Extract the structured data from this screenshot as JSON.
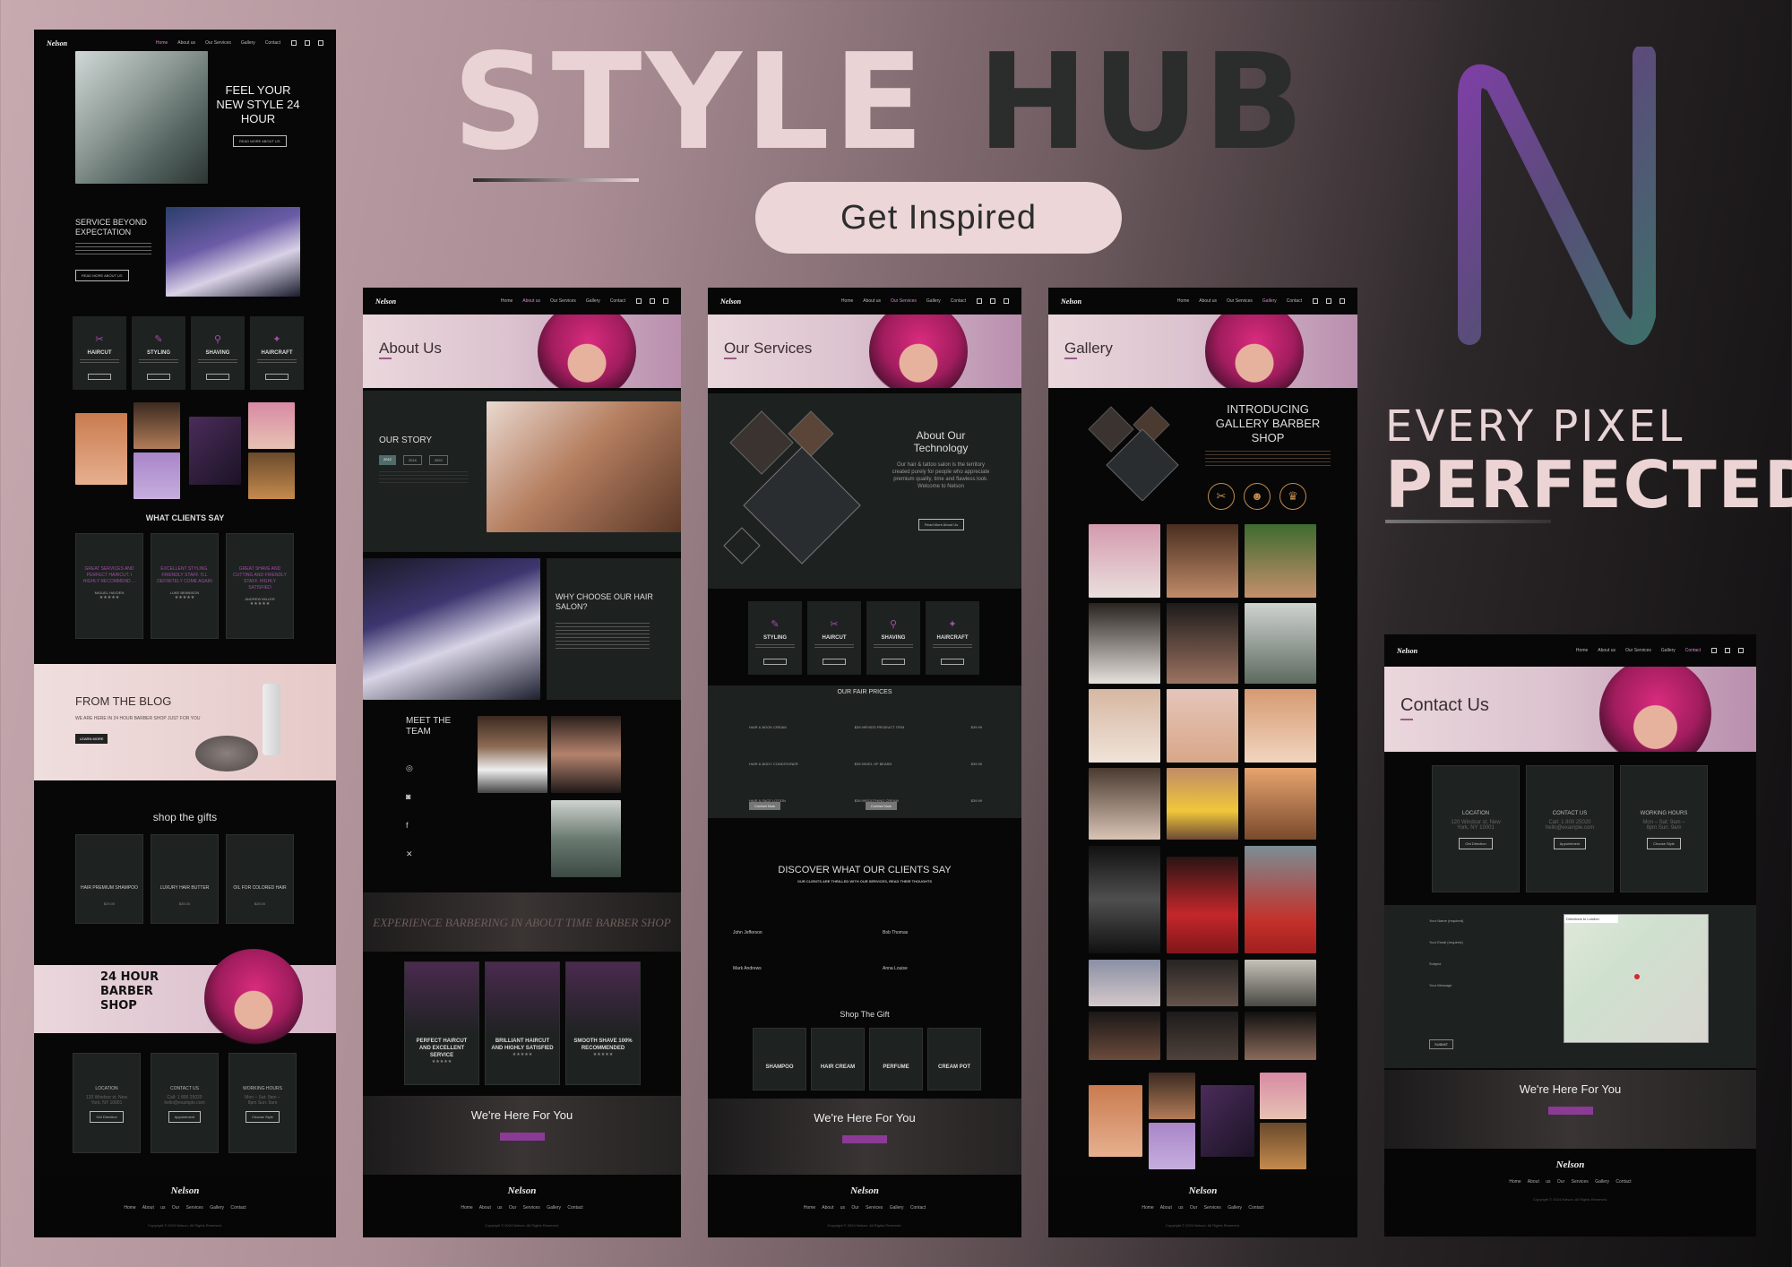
{
  "hero": {
    "title_part1": "STYLE",
    "title_part2": "HUB",
    "cta": "Get Inspired",
    "tagline_line1": "EVERY PIXEL",
    "tagline_line2": "PERFECTED",
    "logo_letter": "N"
  },
  "colors": {
    "accent": "#8b3b96",
    "pink": "#ecd6d7",
    "dark": "#070707",
    "card": "#1e2221"
  },
  "nav": {
    "logo": "Nelson",
    "links": [
      "Home",
      "About us",
      "Our Services",
      "Gallery",
      "Contact"
    ]
  },
  "home": {
    "hero_heading": "FEEL YOUR NEW STYLE 24 HOUR",
    "hero_button": "READ MORE ABOUT US",
    "service_heading": "SERVICE BEYOND EXPECTATION",
    "service_button": "READ MORE ABOUT US",
    "services": [
      "HAIRCUT",
      "STYLING",
      "SHAVING",
      "HAIRCRAFT"
    ],
    "service_btn": "Read more",
    "testimonials_heading": "WHAT CLIENTS SAY",
    "testimonials": [
      {
        "quote": "GREAT SERVICES AND PERFECT HAIRCUT. I HIGHLY RECOMMEND ...",
        "name": "MIGUEL HAYDEN"
      },
      {
        "quote": "EXCELLENT STYLING. FRIENDLY STAFF. I'LL DEFINITELY COME AGAIN",
        "name": "LUKE BENNISON"
      },
      {
        "quote": "GREAT SHAVE AND CUTTING AND FRIENDLY STAFF. HIGHLY SATISFIED",
        "name": "ANDREW MILLER"
      }
    ],
    "stars": "★★★★★",
    "blog_heading": "FROM THE BLOG",
    "blog_text": "WE ARE HERE IN 24 HOUR BARBER SHOP JUST FOR YOU",
    "blog_button": "LEARN MORE",
    "gifts_heading": "shop the gifts",
    "gifts": [
      {
        "name": "HAIR PREMIUM SHAMPOO",
        "price": "$29.00"
      },
      {
        "name": "LUXURY HAIR BUTTER",
        "price": "$35.00"
      },
      {
        "name": "OIL FOR COLORED HAIR",
        "price": "$28.00"
      }
    ],
    "promo": "24 HOUR BARBER SHOP"
  },
  "contact_cards": [
    {
      "title": "LOCATION",
      "line1": "120 Windsor st. New",
      "line2": "York, NY 10001",
      "button": "Get Direction"
    },
    {
      "title": "CONTACT US",
      "line1": "Call: 1 800 25020",
      "line2": "hello@example.com",
      "button": "Appointment"
    },
    {
      "title": "WORKING HOURS",
      "line1": "Mon – Sat: 9am –",
      "line2": "8pm Sun: 9am",
      "button": "Choose Style"
    }
  ],
  "about": {
    "banner": "About Us",
    "story_heading": "OUR STORY",
    "story_tabs": [
      "2012",
      "2016",
      "2020"
    ],
    "why_heading": "WHY CHOOSE OUR HAIR SALON?",
    "team_heading": "MEET THE TEAM",
    "script_banner": "EXPERIENCE BARBERING IN ABOUT TIME BARBER SHOP",
    "features": [
      "PERFECT HAIRCUT AND EXCELLENT SERVICE",
      "BRILLIANT HAIRCUT AND HIGHLY SATISFIED",
      "SMOOTH SHAVE 100% RECOMMENDED"
    ]
  },
  "services_page": {
    "banner": "Our Services",
    "tech_heading": "About Our Technology",
    "tech_text": "Our hair & tattoo salon is the territory created purely for people who appreciate premium quality, time and flawless look. Welcome to Nelson",
    "tech_button": "Read More About Us",
    "services": [
      "STYLING",
      "HAIRCUT",
      "SHAVING",
      "HAIRCRAFT"
    ],
    "prices_heading": "OUR FAIR PRICES",
    "prices_left": [
      "HAIR & BOOK CREAM",
      "HAIR & BODY CONDITIONER",
      "HAIR & FACE LOTION"
    ],
    "prices_right": [
      "FIXED PRODUCT ITEM",
      "GEL OF BEARD",
      "SOOTHING CREAM"
    ],
    "price_value": "$39.99",
    "prices_buttons": [
      "Contact Now",
      "Contact Now"
    ],
    "testimonials_heading": "DISCOVER WHAT OUR CLIENTS SAY",
    "testimonials_sub": "OUR CLIENTS ARE THRILLED WITH OUR SERVICES, READ THEIR THOUGHTS",
    "clients": [
      "John Jefferson",
      "Bob Thomas",
      "Mark Andrews",
      "Anna Louise"
    ],
    "gift_heading": "Shop The Gift",
    "gifts": [
      "SHAMPOO",
      "HAIR CREAM",
      "PERFUME",
      "CREAM POT"
    ]
  },
  "gallery": {
    "banner": "Gallery",
    "intro_heading": "INTRODUCING GALLERY BARBER SHOP"
  },
  "contact_page": {
    "banner": "Contact Us",
    "form_labels": [
      "Your Name (required)",
      "Your Email (required)",
      "Subject",
      "Your Message"
    ],
    "submit": "SUBMIT",
    "map_label": "Directions to London"
  },
  "here_for_you": "We're Here For You",
  "footer": {
    "logo": "Nelson",
    "links": "Home About us Our Services Gallery Contact",
    "copy": "Copyright © 2024 Nelson. All Rights Reserved."
  }
}
